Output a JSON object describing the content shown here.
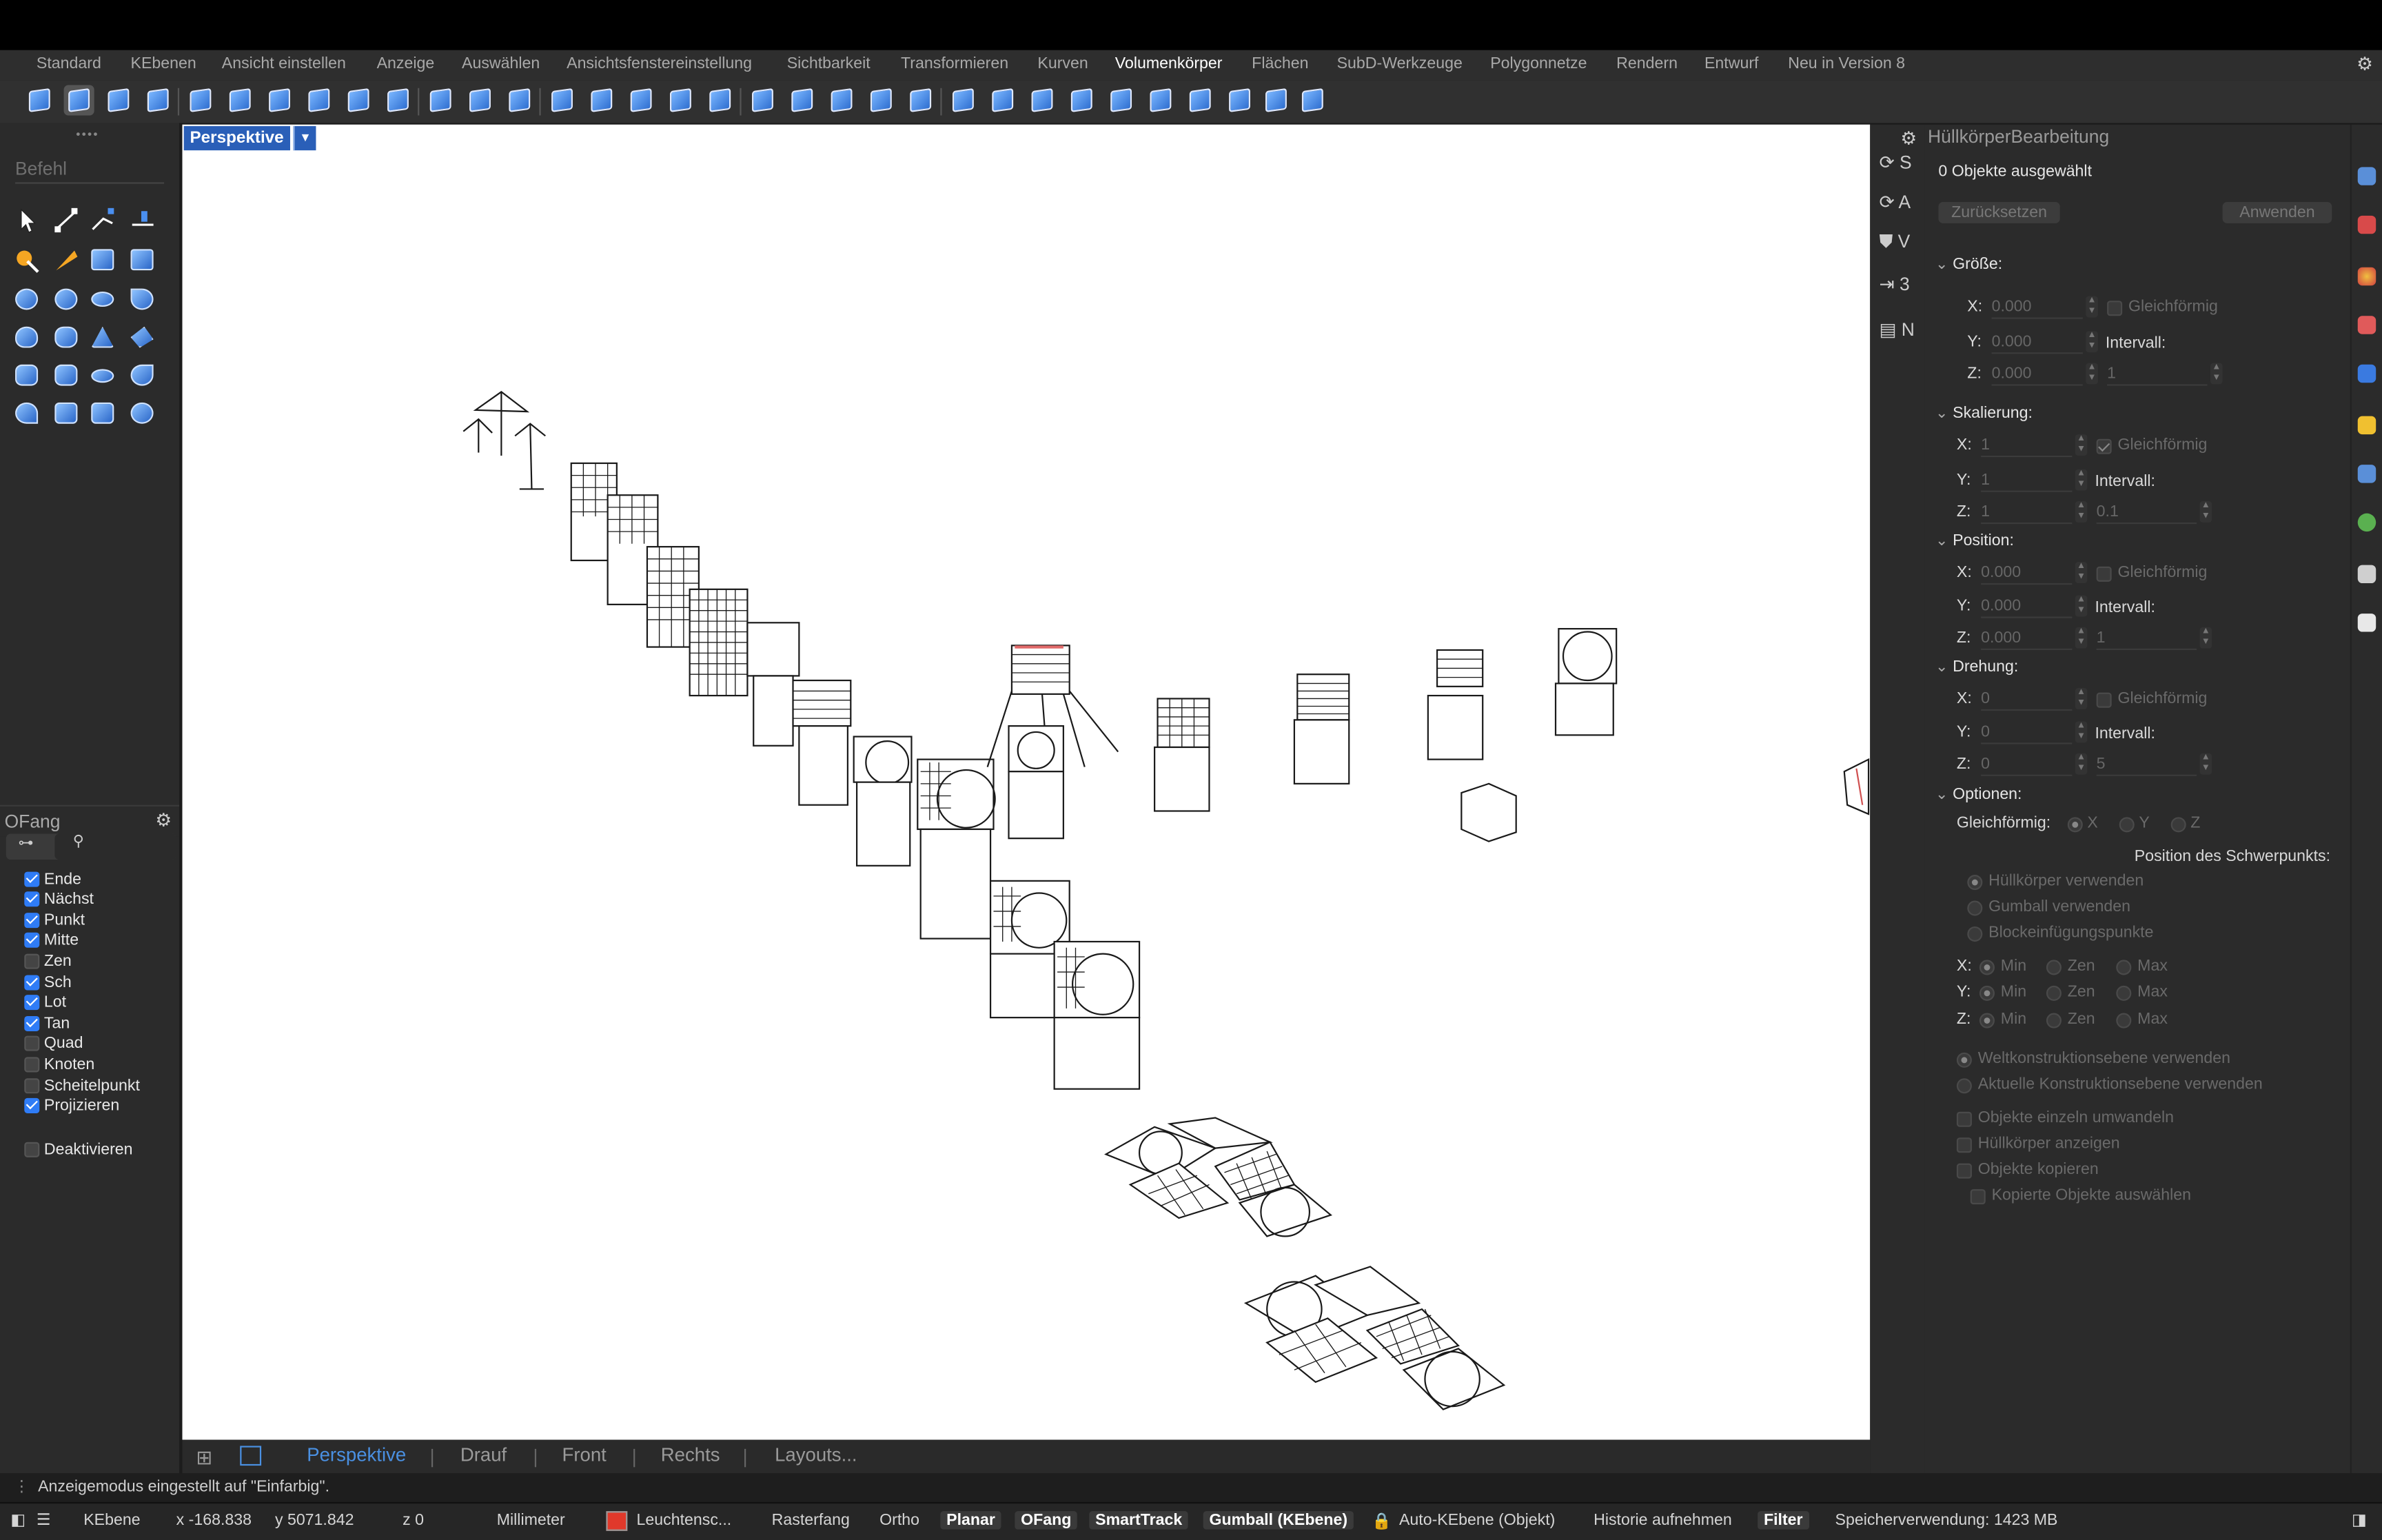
{
  "tabs": [
    "Standard",
    "KEbenen",
    "Ansicht einstellen",
    "Anzeige",
    "Auswählen",
    "Ansichtsfenstereinstellung",
    "Sichtbarkeit",
    "Transformieren",
    "Kurven",
    "Volumenkörper",
    "Flächen",
    "SubD-Werkzeuge",
    "Polygonnetze",
    "Rendern",
    "Entwurf",
    "Neu in Version 8"
  ],
  "active_tab": "Volumenkörper",
  "command_placeholder": "Befehl",
  "ofang": {
    "title": "OFang",
    "items": [
      {
        "label": "Ende",
        "checked": true
      },
      {
        "label": "Nächst",
        "checked": true
      },
      {
        "label": "Punkt",
        "checked": true
      },
      {
        "label": "Mitte",
        "checked": true
      },
      {
        "label": "Zen",
        "checked": false
      },
      {
        "label": "Sch",
        "checked": true
      },
      {
        "label": "Lot",
        "checked": true
      },
      {
        "label": "Tan",
        "checked": true
      },
      {
        "label": "Quad",
        "checked": false
      },
      {
        "label": "Knoten",
        "checked": false
      },
      {
        "label": "Scheitelpunkt",
        "checked": false
      },
      {
        "label": "Projizieren",
        "checked": true
      }
    ],
    "disable_label": "Deaktivieren"
  },
  "viewport": {
    "label": "Perspektive",
    "tabs": [
      "Perspektive",
      "Drauf",
      "Front",
      "Rechts",
      "Layouts..."
    ],
    "active": "Perspektive"
  },
  "midstrip": [
    "S",
    "A",
    "V",
    "3",
    "N"
  ],
  "panel": {
    "title": "HüllkörperBearbeitung",
    "selected": "0 Objekte ausgewählt",
    "reset": "Zurücksetzen",
    "apply": "Anwenden",
    "size": {
      "title": "Größe:",
      "x": "0.000",
      "y": "0.000",
      "z": "0.000",
      "uniform": "Gleichförmig",
      "interval": "Intervall:",
      "interval_value": "1"
    },
    "scale": {
      "title": "Skalierung:",
      "x": "1",
      "y": "1",
      "z": "1",
      "uniform": "Gleichförmig",
      "interval": "Intervall:",
      "interval_value": "0.1"
    },
    "position": {
      "title": "Position:",
      "x": "0.000",
      "y": "0.000",
      "z": "0.000",
      "uniform": "Gleichförmig",
      "interval": "Intervall:",
      "interval_value": "1"
    },
    "rotation": {
      "title": "Drehung:",
      "x": "0",
      "y": "0",
      "z": "0",
      "uniform": "Gleichförmig",
      "interval": "Intervall:",
      "interval_value": "5"
    },
    "options": {
      "title": "Optionen:",
      "uniform_label": "Gleichförmig:",
      "axes": [
        "X",
        "Y",
        "Z"
      ],
      "centroid_title": "Position des Schwerpunkts:",
      "centroid_opts": [
        "Hüllkörper verwenden",
        "Gumball verwenden",
        "Blockeinfügungspunkte"
      ],
      "axis_rows": [
        {
          "axis": "X:"
        },
        {
          "axis": "Y:"
        },
        {
          "axis": "Z:"
        }
      ],
      "axis_opts": [
        "Min",
        "Zen",
        "Max"
      ],
      "plane_opts": [
        "Weltkonstruktionsebene verwenden",
        "Aktuelle Konstruktionsebene verwenden"
      ],
      "checks": [
        "Objekte einzeln umwandeln",
        "Hüllkörper anzeigen",
        "Objekte kopieren",
        "Kopierte Objekte auswählen"
      ]
    }
  },
  "status_message": "Anzeigemodus eingestellt auf \"Einfarbig\".",
  "statusbar": {
    "layer": "KEbene",
    "x": "x -168.838",
    "y": "y 5071.842",
    "z": "z 0",
    "units": "Millimeter",
    "layer_color": "#e0392b",
    "current_layer": "Leuchtensc...",
    "grid_snap": "Rasterfang",
    "ortho": "Ortho",
    "planar": "Planar",
    "osnap": "OFang",
    "smarttrack": "SmartTrack",
    "gumball": "Gumball (KEbene)",
    "autolayer": "Auto-KEbene (Objekt)",
    "history": "Historie aufnehmen",
    "filter": "Filter",
    "memory": "Speicherverwendung: 1423 MB"
  }
}
